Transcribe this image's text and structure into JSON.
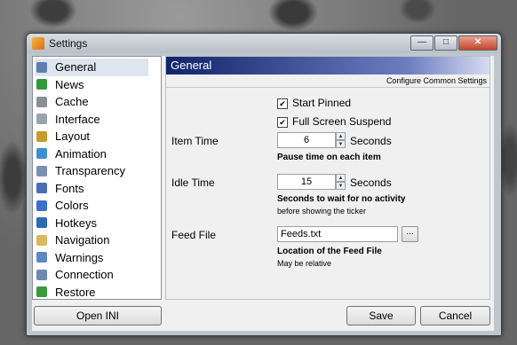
{
  "window": {
    "title": "Settings",
    "minimize": "—",
    "maximize": "□",
    "close": "✕"
  },
  "sidebar": {
    "items": [
      {
        "label": "General",
        "icon": "general-icon",
        "color": "#5b7fb0"
      },
      {
        "label": "News",
        "icon": "news-icon",
        "color": "#2f9b3a"
      },
      {
        "label": "Cache",
        "icon": "cache-icon",
        "color": "#8a8f96"
      },
      {
        "label": "Interface",
        "icon": "interface-icon",
        "color": "#9aa3ad"
      },
      {
        "label": "Layout",
        "icon": "layout-icon",
        "color": "#c79a2a"
      },
      {
        "label": "Animation",
        "icon": "animation-icon",
        "color": "#3a8fd4"
      },
      {
        "label": "Transparency",
        "icon": "transparency-icon",
        "color": "#7b8fb3"
      },
      {
        "label": "Fonts",
        "icon": "fonts-icon",
        "color": "#4a6db8"
      },
      {
        "label": "Colors",
        "icon": "colors-icon",
        "color": "#3b6fd0"
      },
      {
        "label": "Hotkeys",
        "icon": "hotkeys-icon",
        "color": "#2a6bb5"
      },
      {
        "label": "Navigation",
        "icon": "navigation-icon",
        "color": "#d9b85a"
      },
      {
        "label": "Warnings",
        "icon": "warnings-icon",
        "color": "#5f87c7"
      },
      {
        "label": "Connection",
        "icon": "connection-icon",
        "color": "#6d89b2"
      },
      {
        "label": "Restore",
        "icon": "restore-icon",
        "color": "#3a9b3a"
      }
    ]
  },
  "panel": {
    "title": "General",
    "subtitle": "Configure Common Settings",
    "start_pinned": "Start Pinned",
    "fullscreen_suspend": "Full Screen Suspend",
    "item_time": {
      "label": "Item Time",
      "value": "6",
      "unit": "Seconds",
      "hint": "Pause time on each item"
    },
    "idle_time": {
      "label": "Idle Time",
      "value": "15",
      "unit": "Seconds",
      "hint": "Seconds to wait for no activity",
      "hint2": "before showing the ticker"
    },
    "feed_file": {
      "label": "Feed File",
      "value": "Feeds.txt",
      "browse": "...",
      "hint": "Location of the Feed File",
      "hint2": "May be relative"
    }
  },
  "buttons": {
    "open_ini": "Open INI",
    "save": "Save",
    "cancel": "Cancel"
  },
  "checks": {
    "mark": "✔",
    "up": "▲",
    "down": "▼"
  }
}
